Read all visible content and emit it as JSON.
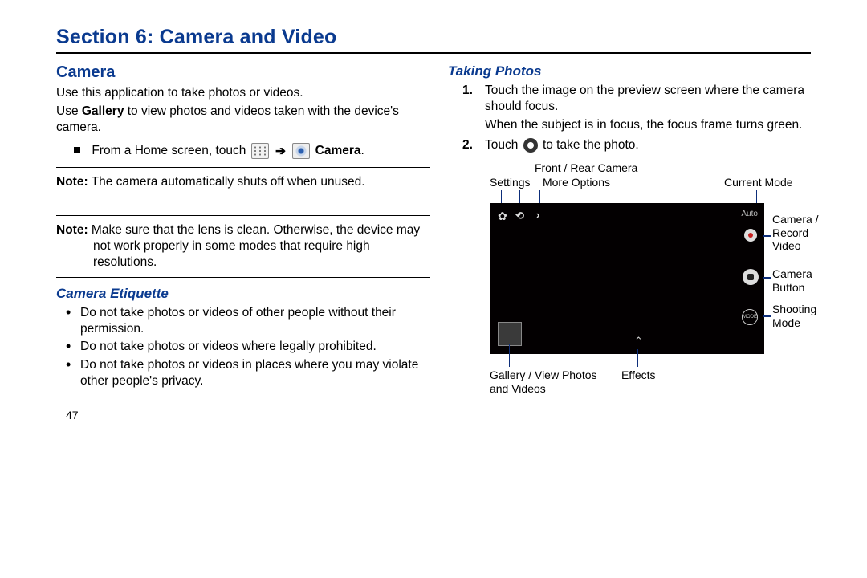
{
  "section_title": "Section 6: Camera and Video",
  "left": {
    "h2": "Camera",
    "p1": "Use this application to take photos or videos.",
    "p2a": "Use ",
    "p2b": "Gallery",
    "p2c": " to view photos and videos taken with the device's camera.",
    "launch_a": "From a Home screen, touch ",
    "launch_b": "Camera",
    "note1a": "Note:",
    "note1b": " The camera automatically shuts off when unused.",
    "note2a": "Note:",
    "note2b": " Make sure that the lens is clean. Otherwise, the device may not work properly in some modes that require high resolutions.",
    "h3": "Camera Etiquette",
    "b1": "Do not take photos or videos of other people without their permission.",
    "b2": "Do not take photos or videos where legally prohibited.",
    "b3": "Do not take photos or videos in places where you may violate other people's privacy."
  },
  "right": {
    "h3": "Taking Photos",
    "s1": "Touch the image on the preview screen where the camera should focus.",
    "s1b": "When the subject is in focus, the focus frame turns green.",
    "s2a": "Touch ",
    "s2b": " to take the photo.",
    "labels": {
      "settings": "Settings",
      "frontRear": "Front / Rear Camera",
      "moreOptions": "More Options",
      "currentMode": "Current Mode",
      "camRecord": "Camera / Record Video",
      "camButton": "Camera Button",
      "shootMode": "Shooting Mode",
      "gallery": "Gallery / View Photos and Videos",
      "effects": "Effects",
      "auto": "Auto",
      "mode": "MODE"
    }
  },
  "page_num": "47"
}
